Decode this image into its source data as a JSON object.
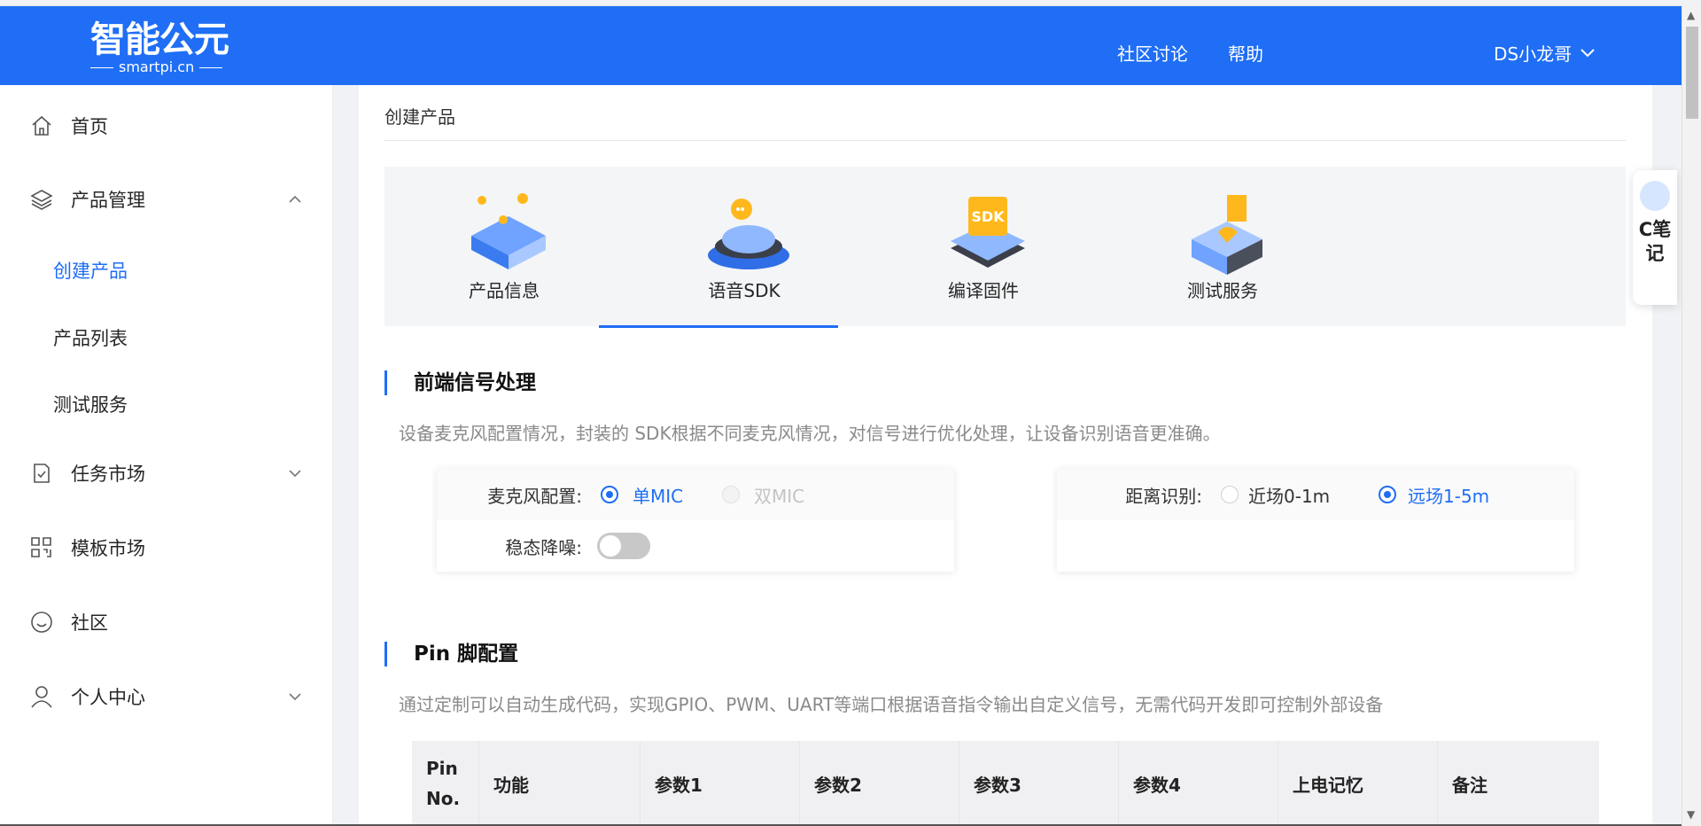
{
  "header": {
    "logo_text": "智能公元",
    "logo_sub": "smartpi.cn",
    "nav": [
      "社区讨论",
      "帮助"
    ],
    "user_name": "DS小龙哥"
  },
  "sidebar": {
    "items": [
      {
        "label": "首页",
        "icon": "home-icon"
      },
      {
        "label": "产品管理",
        "icon": "layers-icon",
        "expanded": true
      },
      {
        "label": "任务市场",
        "icon": "task-icon",
        "expanded": false
      },
      {
        "label": "模板市场",
        "icon": "grid-icon"
      },
      {
        "label": "社区",
        "icon": "smile-icon"
      },
      {
        "label": "个人中心",
        "icon": "user-icon",
        "expanded": false
      }
    ],
    "sub_items": [
      "创建产品",
      "产品列表",
      "测试服务"
    ],
    "active_sub": "创建产品"
  },
  "main": {
    "page_title": "创建产品",
    "steps": [
      {
        "label": "产品信息"
      },
      {
        "label": "语音SDK",
        "active": true
      },
      {
        "label": "编译固件"
      },
      {
        "label": "测试服务"
      }
    ],
    "frontend": {
      "title": "前端信号处理",
      "desc": "设备麦克风配置情况，封装的 SDK根据不同麦克风情况，对信号进行优化处理，让设备识别语音更准确。",
      "mic_label": "麦克风配置:",
      "mic_options": [
        "单MIC",
        "双MIC"
      ],
      "mic_selected": "单MIC",
      "noise_label": "稳态降噪:",
      "noise_on": false,
      "distance_label": "距离识别:",
      "distance_options": [
        "近场0-1m",
        "远场1-5m"
      ],
      "distance_selected": "远场1-5m"
    },
    "pin": {
      "title": "Pin 脚配置",
      "desc": "通过定制可以自动生成代码，实现GPIO、PWM、UART等端口根据语音指令输出自定义信号，无需代码开发即可控制外部设备",
      "columns": [
        "Pin No.",
        "功能",
        "参数1",
        "参数2",
        "参数3",
        "参数4",
        "上电记忆",
        "备注"
      ]
    }
  },
  "note_widget": {
    "text": "C笔记"
  },
  "colors": {
    "accent": "#1f6ef5",
    "header_bg": "#1f6ef5"
  }
}
